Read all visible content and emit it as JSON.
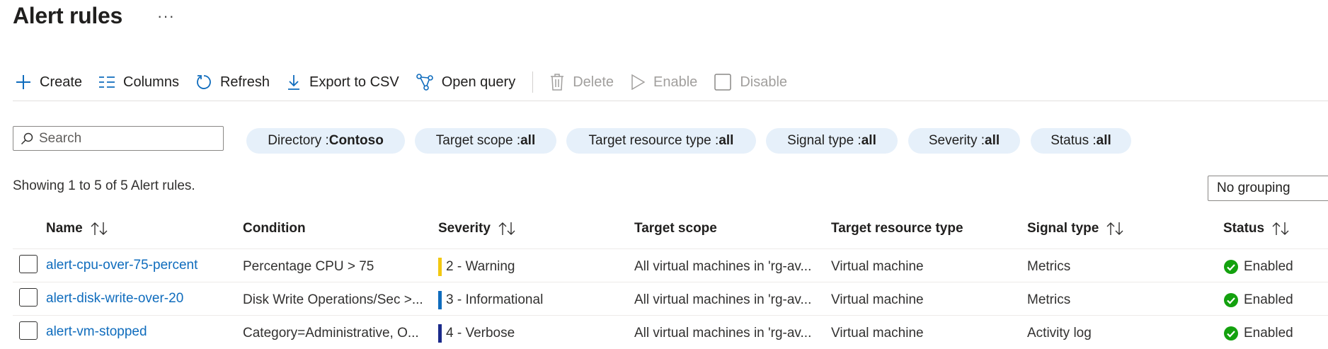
{
  "page": {
    "title": "Alert rules",
    "more_label": "···"
  },
  "toolbar": {
    "create": "Create",
    "columns": "Columns",
    "refresh": "Refresh",
    "export": "Export to CSV",
    "open_query": "Open query",
    "delete": "Delete",
    "enable": "Enable",
    "disable": "Disable"
  },
  "search": {
    "placeholder": "Search",
    "value": ""
  },
  "filters": [
    {
      "label": "Directory : ",
      "value": "Contoso"
    },
    {
      "label": "Target scope : ",
      "value": "all"
    },
    {
      "label": "Target resource type : ",
      "value": "all"
    },
    {
      "label": "Signal type : ",
      "value": "all"
    },
    {
      "label": "Severity : ",
      "value": "all"
    },
    {
      "label": "Status : ",
      "value": "all"
    }
  ],
  "summary": "Showing 1 to 5 of 5 Alert rules.",
  "grouping": "No grouping",
  "columns": {
    "name": "Name",
    "condition": "Condition",
    "severity": "Severity",
    "target_scope": "Target scope",
    "target_resource_type": "Target resource type",
    "signal_type": "Signal type",
    "status": "Status"
  },
  "rows": [
    {
      "name": "alert-cpu-over-75-percent",
      "condition": "Percentage CPU > 75",
      "severity": "2 - Warning",
      "severity_color": "#f2c811",
      "target_scope": "All virtual machines in 'rg-av...",
      "target_resource_type": "Virtual machine",
      "signal_type": "Metrics",
      "status": "Enabled"
    },
    {
      "name": "alert-disk-write-over-20",
      "condition": "Disk Write Operations/Sec >...",
      "severity": "3 - Informational",
      "severity_color": "#0f6cbd",
      "target_scope": "All virtual machines in 'rg-av...",
      "target_resource_type": "Virtual machine",
      "signal_type": "Metrics",
      "status": "Enabled"
    },
    {
      "name": "alert-vm-stopped",
      "condition": "Category=Administrative, O...",
      "severity": "4 - Verbose",
      "severity_color": "#1b2a8a",
      "target_scope": "All virtual machines in 'rg-av...",
      "target_resource_type": "Virtual machine",
      "signal_type": "Activity log",
      "status": "Enabled"
    }
  ],
  "colors": {
    "accent": "#0f6cbd",
    "pill_bg": "#e6f0fa",
    "enabled": "#13a10e"
  }
}
